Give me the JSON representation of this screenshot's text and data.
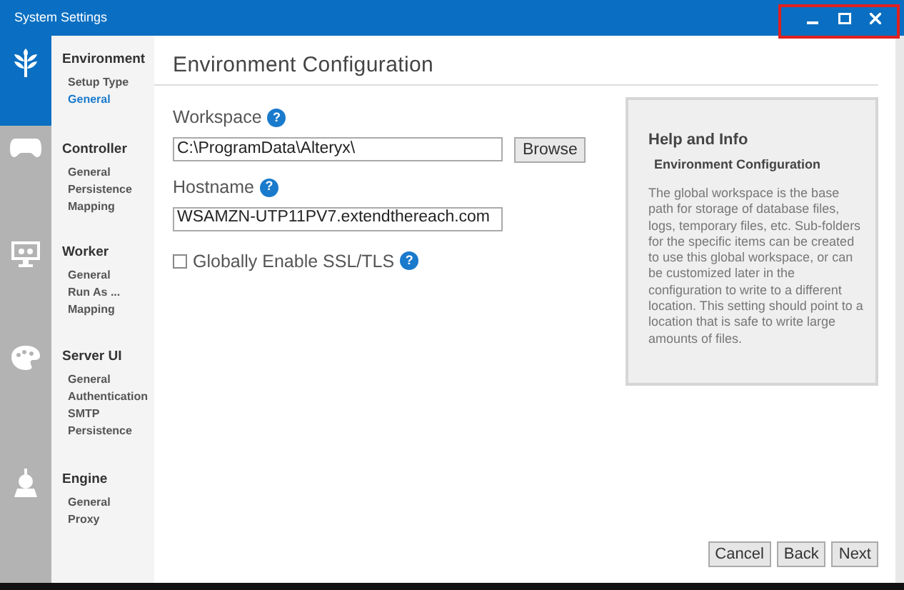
{
  "window": {
    "title": "System Settings"
  },
  "sections": [
    {
      "kind": "plant",
      "name": "Environment",
      "selected": true,
      "items": [
        {
          "label": "Setup Type",
          "selected": false
        },
        {
          "label": "General",
          "selected": true
        }
      ]
    },
    {
      "kind": "gamepad",
      "name": "Controller",
      "selected": false,
      "items": [
        {
          "label": "General",
          "selected": false
        },
        {
          "label": "Persistence",
          "selected": false
        },
        {
          "label": "Mapping",
          "selected": false
        }
      ]
    },
    {
      "kind": "monitor",
      "name": "Worker",
      "selected": false,
      "items": [
        {
          "label": "General",
          "selected": false
        },
        {
          "label": "Run As ...",
          "selected": false
        },
        {
          "label": "Mapping",
          "selected": false
        }
      ]
    },
    {
      "kind": "palette",
      "name": "Server UI",
      "selected": false,
      "items": [
        {
          "label": "General",
          "selected": false
        },
        {
          "label": "Authentication",
          "selected": false
        },
        {
          "label": "SMTP",
          "selected": false
        },
        {
          "label": "Persistence",
          "selected": false
        }
      ]
    },
    {
      "kind": "engine",
      "name": "Engine",
      "selected": false,
      "items": [
        {
          "label": "General",
          "selected": false
        },
        {
          "label": "Proxy",
          "selected": false
        }
      ]
    }
  ],
  "page": {
    "title": "Environment Configuration",
    "fields": [
      {
        "label": "Workspace",
        "help": "?",
        "value": "C:\\ProgramData\\Alteryx\\",
        "button": "Browse"
      },
      {
        "label": "Hostname",
        "help": "?",
        "value": "WSAMZN-UTP11PV7.extendthereach.com"
      }
    ],
    "checkbox": {
      "label": "Globally Enable SSL/TLS",
      "checked": false,
      "help": "?"
    }
  },
  "help_panel": {
    "title": "Help and Info",
    "subtitle": "Environment Configuration",
    "body": "The global workspace is the base path for storage of database files, logs, temporary files, etc. Sub-folders for the specific items can be created to use this global workspace, or can be customized later in the configuration to write to a different location. This setting should point to a location that is safe to write large amounts of files."
  },
  "buttons": [
    "Cancel",
    "Back",
    "Next"
  ]
}
